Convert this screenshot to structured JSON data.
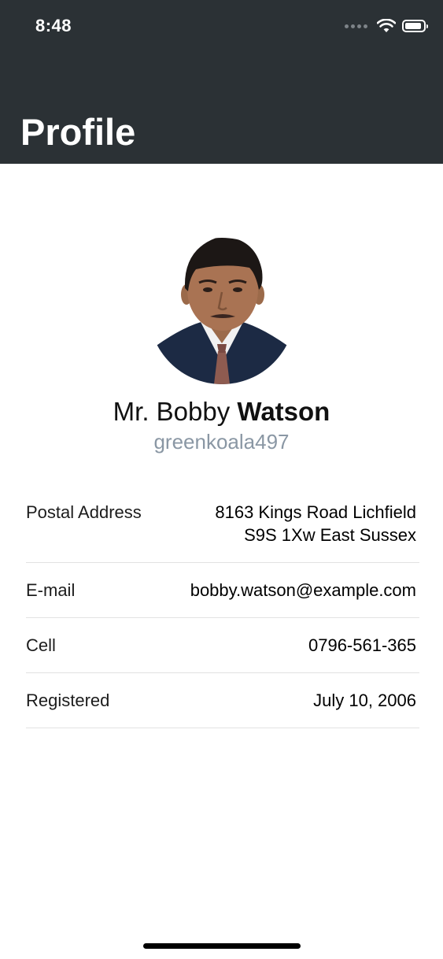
{
  "status_bar": {
    "time": "8:48",
    "icons": [
      "cellular-signal-icon",
      "wifi-icon",
      "battery-icon"
    ]
  },
  "header": {
    "title": "Profile",
    "background_color": "#2b3135"
  },
  "profile": {
    "title_prefix": "Mr.",
    "first_name": "Bobby",
    "last_name": "Watson",
    "username": "greenkoala497",
    "username_color": "#8a97a4"
  },
  "details": {
    "address": {
      "label": "Postal Address",
      "line1": "8163 Kings Road Lichfield",
      "line2": "S9S 1Xw East Sussex"
    },
    "email": {
      "label": "E-mail",
      "value": "bobby.watson@example.com"
    },
    "cell": {
      "label": "Cell",
      "value": "0796-561-365"
    },
    "registered": {
      "label": "Registered",
      "value": "July 10, 2006"
    }
  }
}
